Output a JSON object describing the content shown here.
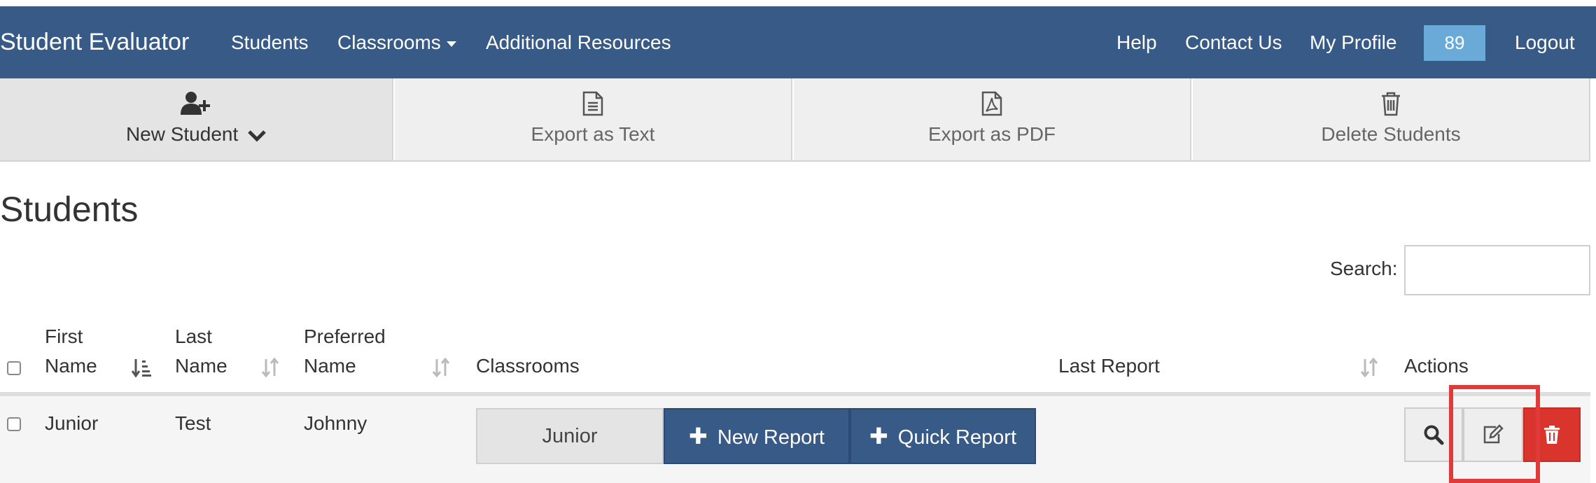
{
  "navbar": {
    "brand": "Student Evaluator",
    "left_links": [
      {
        "label": "Students"
      },
      {
        "label": "Classrooms"
      },
      {
        "label": "Additional Resources"
      }
    ],
    "right_links": [
      {
        "label": "Help"
      },
      {
        "label": "Contact Us"
      },
      {
        "label": "My Profile"
      }
    ],
    "badge": "89",
    "logout": "Logout",
    "background_color": "#375a86",
    "badge_color": "#6aaad8"
  },
  "toolbar": {
    "items": [
      {
        "label": "New Student",
        "icon": "add-user-icon",
        "has_dropdown": true
      },
      {
        "label": "Export as Text",
        "icon": "text-file-icon"
      },
      {
        "label": "Export as PDF",
        "icon": "pdf-file-icon"
      },
      {
        "label": "Delete Students",
        "icon": "trash-icon"
      }
    ]
  },
  "page": {
    "title": "Students",
    "search_label": "Search:",
    "search_value": ""
  },
  "table": {
    "headers": {
      "first_name": [
        "First",
        "Name"
      ],
      "last_name": [
        "Last",
        "Name"
      ],
      "preferred_name": [
        "Preferred",
        "Name"
      ],
      "classrooms": "Classrooms",
      "last_report": "Last Report",
      "actions": "Actions"
    },
    "rows": [
      {
        "selected": false,
        "first_name": "Junior",
        "last_name": "Test",
        "preferred_name": "Johnny",
        "classroom": "Junior",
        "new_report": "New Report",
        "quick_report": "Quick Report",
        "last_report": ""
      }
    ]
  },
  "colors": {
    "primary": "#375a86",
    "danger": "#d9352c",
    "highlight": "#e03a3a"
  }
}
